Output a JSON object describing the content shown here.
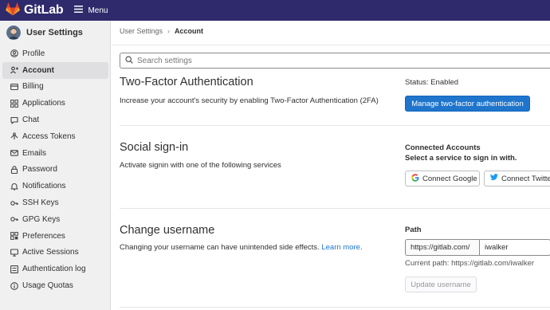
{
  "topbar": {
    "brand": "GitLab",
    "menu_label": "Menu"
  },
  "sidebar": {
    "title": "User Settings",
    "items": [
      {
        "label": "Profile",
        "icon": "profile-icon",
        "active": false
      },
      {
        "label": "Account",
        "icon": "account-icon",
        "active": true
      },
      {
        "label": "Billing",
        "icon": "billing-icon",
        "active": false
      },
      {
        "label": "Applications",
        "icon": "applications-icon",
        "active": false
      },
      {
        "label": "Chat",
        "icon": "chat-icon",
        "active": false
      },
      {
        "label": "Access Tokens",
        "icon": "token-icon",
        "active": false
      },
      {
        "label": "Emails",
        "icon": "mail-icon",
        "active": false
      },
      {
        "label": "Password",
        "icon": "lock-icon",
        "active": false
      },
      {
        "label": "Notifications",
        "icon": "bell-icon",
        "active": false
      },
      {
        "label": "SSH Keys",
        "icon": "key-icon",
        "active": false
      },
      {
        "label": "GPG Keys",
        "icon": "key-icon",
        "active": false
      },
      {
        "label": "Preferences",
        "icon": "preferences-icon",
        "active": false
      },
      {
        "label": "Active Sessions",
        "icon": "monitor-icon",
        "active": false
      },
      {
        "label": "Authentication log",
        "icon": "list-icon",
        "active": false
      },
      {
        "label": "Usage Quotas",
        "icon": "info-icon",
        "active": false
      }
    ]
  },
  "breadcrumb": {
    "parent": "User Settings",
    "separator": "›",
    "current": "Account"
  },
  "search": {
    "placeholder": "Search settings"
  },
  "two_factor": {
    "title": "Two-Factor Authentication",
    "description": "Increase your account's security by enabling Two-Factor Authentication (2FA)",
    "status": "Status: Enabled",
    "button": "Manage two-factor authentication"
  },
  "social": {
    "title": "Social sign-in",
    "description": "Activate signin with one of the following services",
    "connected_label": "Connected Accounts",
    "select_label": "Select a service to sign in with.",
    "google_button": "Connect Google",
    "twitter_button": "Connect Twitter"
  },
  "username": {
    "title": "Change username",
    "description": "Changing your username can have unintended side effects.",
    "learn_more": "Learn more",
    "period": ".",
    "path_label": "Path",
    "prefix": "https://gitlab.com/",
    "value": "iwalker",
    "current_path": "Current path: https://gitlab.com/iwalker",
    "update_button": "Update username"
  },
  "colors": {
    "topbar": "#2f2a6b",
    "primary": "#1f75cb",
    "sidebar_bg": "#f0f0f0",
    "active_item": "#dfdfe1"
  }
}
